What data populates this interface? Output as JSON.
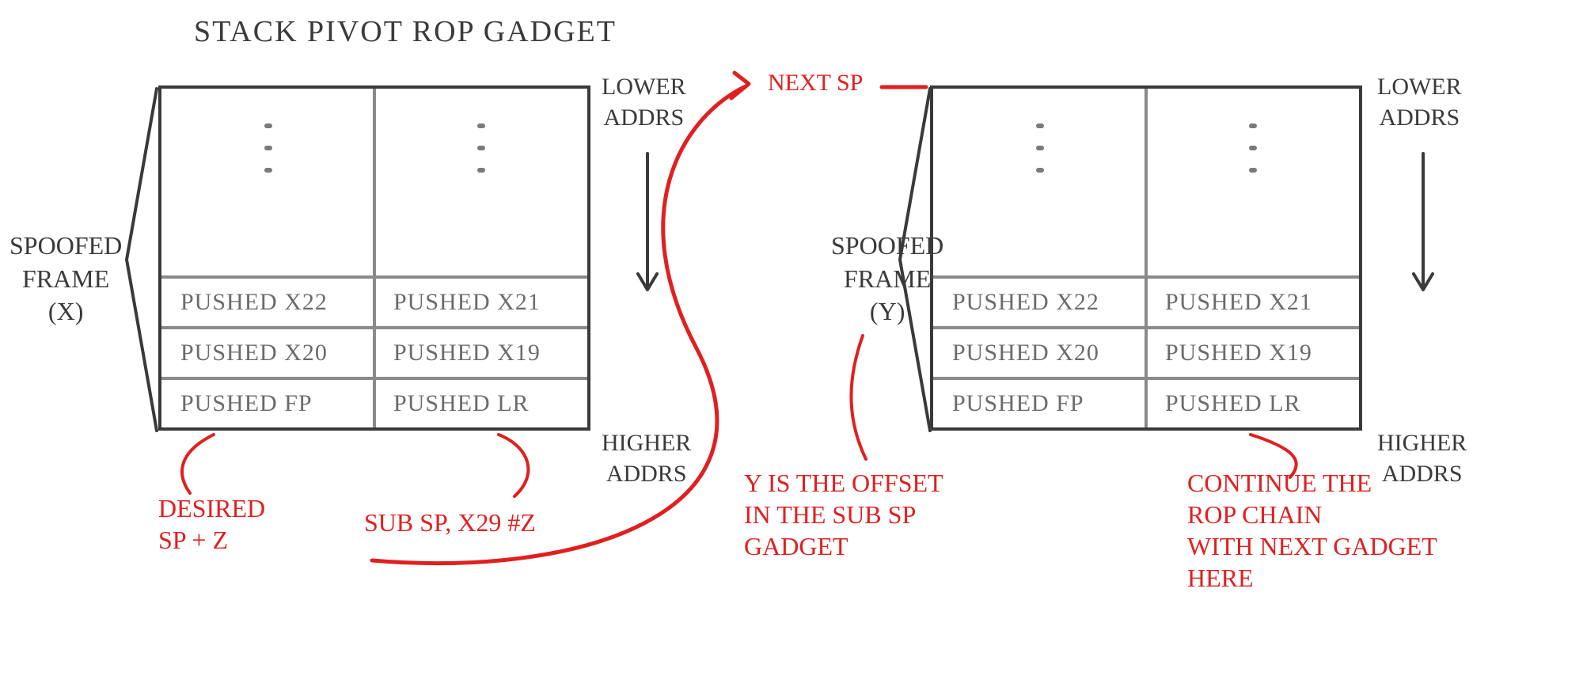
{
  "title": "STACK PIVOT ROP GADGET",
  "labels": {
    "lower_addrs": "LOWER\nADDRS",
    "higher_addrs": "HIGHER\nADDRS",
    "spoofed_frame_x": "SPOOFED\nFRAME\n(X)",
    "spoofed_frame_y": "SPOOFED\nFRAME\n(Y)"
  },
  "frame_x": {
    "rows": [
      [
        "PUSHED X22",
        "PUSHED X21"
      ],
      [
        "PUSHED X20",
        "PUSHED X19"
      ],
      [
        "PUSHED FP",
        "PUSHED LR"
      ]
    ]
  },
  "frame_y": {
    "rows": [
      [
        "PUSHED X22",
        "PUSHED X21"
      ],
      [
        "PUSHED X20",
        "PUSHED X19"
      ],
      [
        "PUSHED FP",
        "PUSHED LR"
      ]
    ]
  },
  "annotations": {
    "desired_sp": "DESIRED\nSP + Z",
    "sub_sp": "SUB SP, X29 #Z",
    "next_sp": "NEXT SP",
    "y_offset": "Y IS THE OFFSET\nIN THE SUB SP\nGADGET",
    "continue_rop": "CONTINUE THE\nROP CHAIN\nWITH NEXT GADGET\nHERE"
  },
  "colors": {
    "ink": "#3a3a3a",
    "grid": "#8a8a8a",
    "red": "#e02020",
    "cell_text": "#6b6b6b"
  }
}
